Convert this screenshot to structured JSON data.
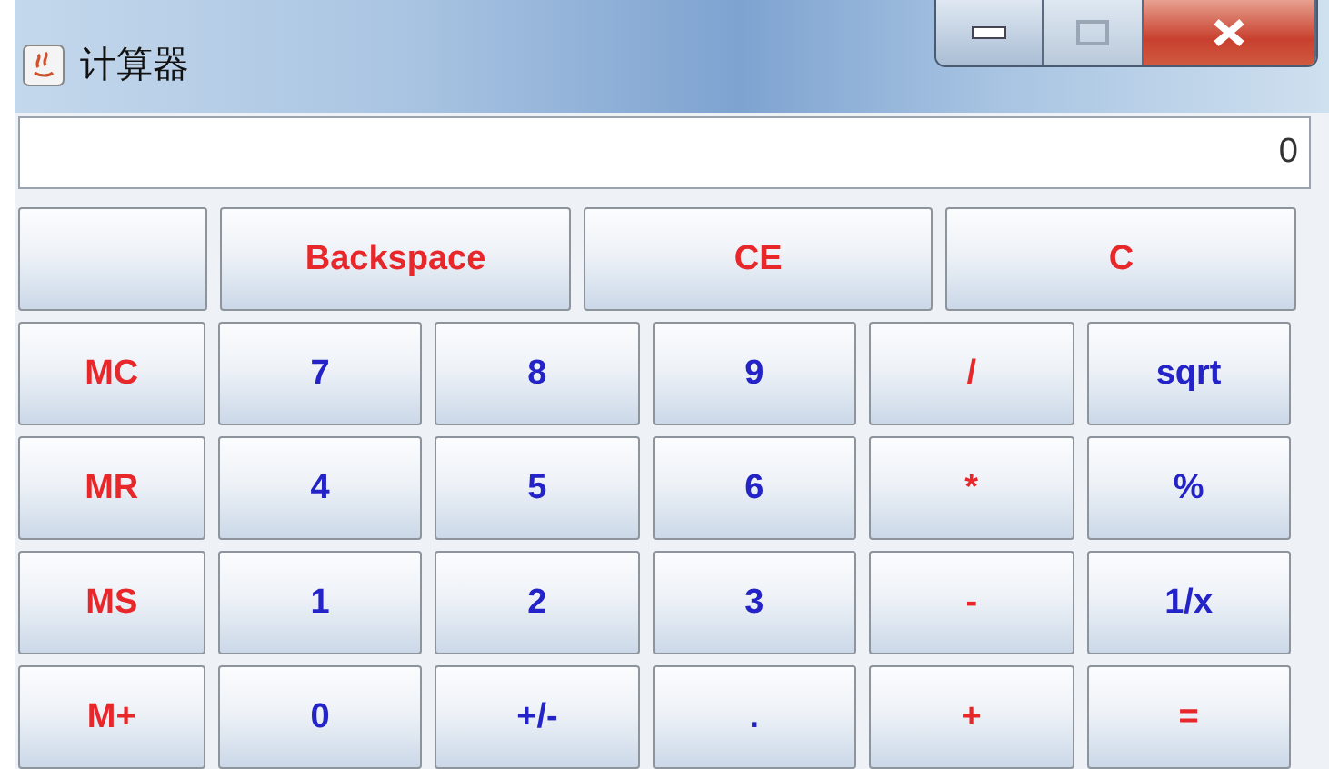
{
  "window": {
    "title": "计算器"
  },
  "display": {
    "value": "0"
  },
  "top_row": [
    {
      "kind": "blank"
    },
    {
      "label": "Backspace",
      "color": "#e8272b"
    },
    {
      "label": "CE",
      "color": "#e8272b"
    },
    {
      "label": "C",
      "color": "#e8272b"
    }
  ],
  "keypad": [
    [
      {
        "label": "MC",
        "color": "#e8272b"
      },
      {
        "label": "7",
        "color": "#2323c8"
      },
      {
        "label": "8",
        "color": "#2323c8"
      },
      {
        "label": "9",
        "color": "#2323c8"
      },
      {
        "label": "/",
        "color": "#e8272b"
      },
      {
        "label": "sqrt",
        "color": "#2323c8"
      }
    ],
    [
      {
        "label": "MR",
        "color": "#e8272b"
      },
      {
        "label": "4",
        "color": "#2323c8"
      },
      {
        "label": "5",
        "color": "#2323c8"
      },
      {
        "label": "6",
        "color": "#2323c8"
      },
      {
        "label": "*",
        "color": "#e8272b"
      },
      {
        "label": "%",
        "color": "#2323c8"
      }
    ],
    [
      {
        "label": "MS",
        "color": "#e8272b"
      },
      {
        "label": "1",
        "color": "#2323c8"
      },
      {
        "label": "2",
        "color": "#2323c8"
      },
      {
        "label": "3",
        "color": "#2323c8"
      },
      {
        "label": "-",
        "color": "#e8272b"
      },
      {
        "label": "1/x",
        "color": "#2323c8"
      }
    ],
    [
      {
        "label": "M+",
        "color": "#e8272b"
      },
      {
        "label": "0",
        "color": "#2323c8"
      },
      {
        "label": "+/-",
        "color": "#2323c8"
      },
      {
        "label": ".",
        "color": "#2323c8"
      },
      {
        "label": "+",
        "color": "#e8272b"
      },
      {
        "label": "=",
        "color": "#e8272b"
      }
    ]
  ]
}
